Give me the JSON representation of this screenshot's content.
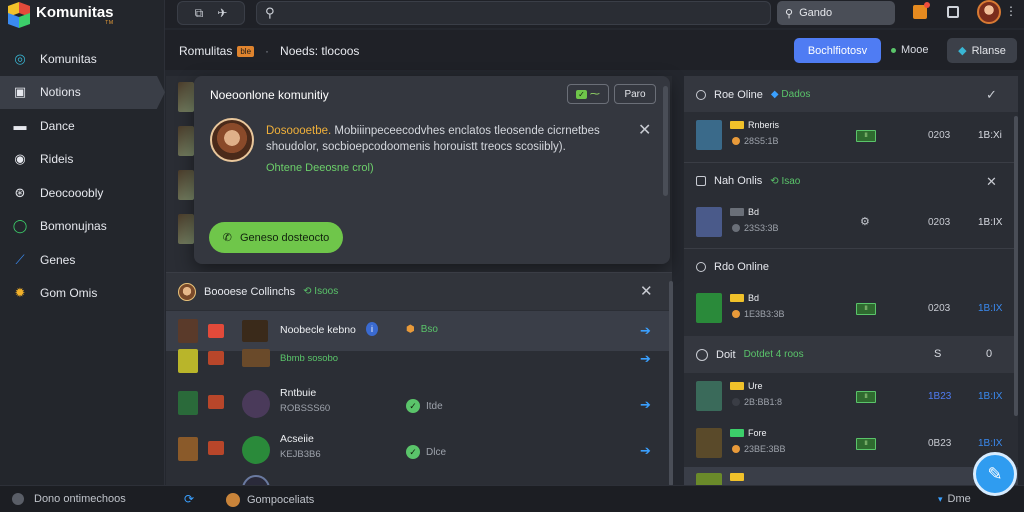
{
  "app": {
    "title": "Komunitas",
    "subtitle": "TM"
  },
  "topbar": {
    "search_placeholder": "",
    "global_search_label": "Gando"
  },
  "sidebar": {
    "items": [
      {
        "label": "Komunitas",
        "icon": "globe-icon",
        "color": "#39b6d4"
      },
      {
        "label": "Notions",
        "icon": "briefcase-icon",
        "color": "#d8dbe2"
      },
      {
        "label": "Dance",
        "icon": "card-icon",
        "color": "#d8dbe2"
      },
      {
        "label": "Rideis",
        "icon": "circle-icon",
        "color": "#d8dbe2"
      },
      {
        "label": "Deocooobly",
        "icon": "compass-icon",
        "color": "#d8dbe2"
      },
      {
        "label": "Bomonujnas",
        "icon": "ring-icon",
        "color": "#3ccf6a"
      },
      {
        "label": "Genes",
        "icon": "chart-icon",
        "color": "#3a8af0"
      },
      {
        "label": "Gom Omis",
        "icon": "sun-icon",
        "color": "#f2b12a"
      }
    ]
  },
  "header": {
    "crumb_title": "Romulitas",
    "crumb_badge": "ble",
    "crumb_sep": "·",
    "crumb_page": "Noeds: tlocoos",
    "primary_button": "Bochlfiotosv",
    "mode_label": "Mooe",
    "secondary_button": "Rlanse"
  },
  "popup": {
    "title": "Noeoonlone komunitiy",
    "pill_green": "⁓",
    "pill_gray": "Paro",
    "highlight": "Dosoooetbe.",
    "message": " Mobiiinpeceecodvhes enclatos tleosende cicrnetbes shoudolor, socbioepcodoomenis horouistt treocs scosiibly).",
    "online_text": "Ohtene Deeosne crol)",
    "call_button": "Geneso dosteocto"
  },
  "friends_card": {
    "title": "Boooese Collinchs",
    "status": "Isoos",
    "rows": [
      {
        "name": "Noobecle kebno",
        "sub": "",
        "mid": "Bso",
        "selected": true,
        "hero_color": "#6b4a2a",
        "flag_color": "#e24a3a",
        "pic_color": "#3a2a1a"
      },
      {
        "name": "",
        "sub": "Bbmb sosobo",
        "mid": "",
        "selected": false,
        "hero_color": "#b9b52a",
        "flag_color": "#b8462a",
        "pic_color": "#6a4a2a"
      },
      {
        "name": "Rntbuie",
        "sub": "ROBSSS60",
        "mid": "Itde",
        "selected": false,
        "hero_color": "#2a6a3a",
        "flag_color": "#b8462a",
        "pic_color": "#4a3a5a"
      },
      {
        "name": "Acseiie",
        "sub": "KEJB3B6",
        "mid": "Dlce",
        "selected": false,
        "hero_color": "#8a5a2a",
        "flag_color": "#b8462a",
        "pic_color": "#2a8a3a"
      },
      {
        "name": "",
        "sub": "",
        "mid": "",
        "selected": false,
        "hero_color": "#3a3a6a",
        "flag_color": "#b8462a",
        "pic_color": "#2a2a3a"
      }
    ]
  },
  "right_panel": {
    "groups": [
      {
        "title": "Roe Oline",
        "status": "Dados",
        "control": "✓"
      },
      {
        "title": "Nah Onlis",
        "status": "Isao",
        "control": "✕"
      },
      {
        "title": "Rdo Online",
        "status": "",
        "control": ""
      },
      {
        "title": "Doit",
        "status": "Dotdet 4 roos",
        "control": ""
      }
    ],
    "rows": [
      {
        "tag": "Rnberis",
        "sub": "28S5:1B",
        "badge": "II",
        "v1": "0203",
        "v2": "1B:Xi",
        "hero": "#3a6a8a",
        "v1_color": "#c8cbd2",
        "v2_color": "#d8dbe2"
      },
      {
        "tag": "Bd",
        "sub": "23S3:3B",
        "badge": "",
        "v1": "0203",
        "v2": "1B:IX",
        "hero": "#4a5a8a",
        "v1_color": "#c8cbd2",
        "v2_color": "#d8dbe2"
      },
      {
        "tag": "Bd",
        "sub": "1E3B3:3B",
        "badge": "II",
        "v1": "0203",
        "v2": "1B:IX",
        "hero": "#2a8a3a",
        "v1_color": "#c8cbd2",
        "v2_color": "#3a8af0"
      },
      {
        "tag": "Ure",
        "sub": "2B:BB1:8",
        "badge": "II",
        "v1": "1B23",
        "v2": "1B:IX",
        "hero": "#3a6a5a",
        "v1_color": "#4f7cf3",
        "v2_color": "#3a8af0"
      },
      {
        "tag": "Fore",
        "sub": "23BE:3BB",
        "badge": "II",
        "v1": "0B23",
        "v2": "1B:IX",
        "hero": "#5a4a2a",
        "v1_color": "#c8cbd2",
        "v2_color": "#3a8af0"
      },
      {
        "tag": "",
        "sub": "",
        "badge": "",
        "v1": "",
        "v2": "",
        "hero": "#6a8a2a",
        "v1_color": "#c8cbd2",
        "v2_color": "#3a8af0"
      }
    ],
    "group_extra": {
      "doit_v1": "S",
      "doit_v2": "0"
    }
  },
  "bottombar": {
    "status_text": "Dono ontimechoos",
    "comp_text": "Gompoceliats",
    "online_text": "Dme"
  },
  "icons": {
    "chat_fab": "chat-bubble-icon"
  }
}
